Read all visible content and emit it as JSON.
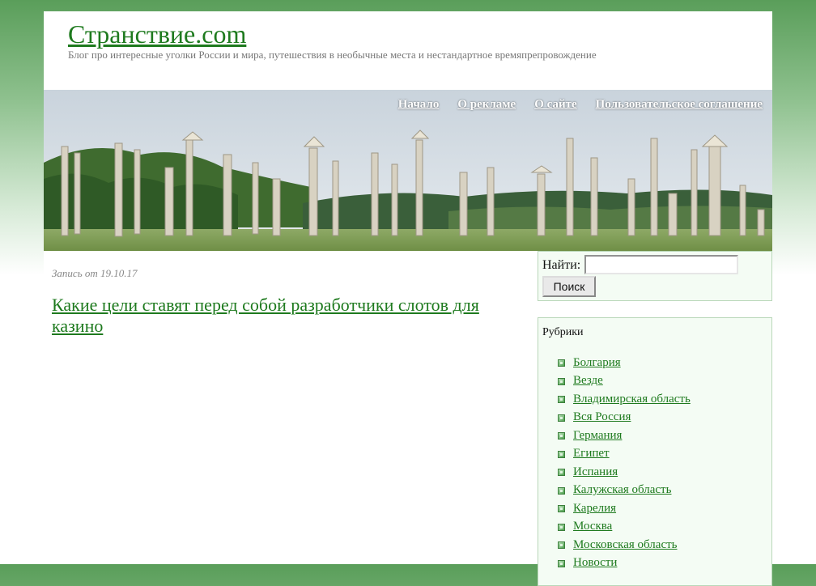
{
  "header": {
    "site_title": "Странствие.com",
    "tagline": "Блог про интересные уголки России и мира, путешествия в необычные места и нестандартное времяпрепровождение"
  },
  "nav": [
    {
      "label": "Начало"
    },
    {
      "label": "О рекламе"
    },
    {
      "label": "О сайте"
    },
    {
      "label": "Пользовательское соглашение"
    }
  ],
  "post": {
    "date": "Запись от 19.10.17",
    "title": "Какие цели ставят перед собой разработчики слотов для казино"
  },
  "search": {
    "label": "Найти:",
    "value": "",
    "button_label": "Поиск"
  },
  "categories": {
    "title": "Рубрики",
    "items": [
      {
        "label": "Болгария"
      },
      {
        "label": "Везде"
      },
      {
        "label": "Владимирская область"
      },
      {
        "label": "Вся Россия"
      },
      {
        "label": "Германия"
      },
      {
        "label": "Египет"
      },
      {
        "label": "Испания"
      },
      {
        "label": "Калужская область"
      },
      {
        "label": "Карелия"
      },
      {
        "label": "Москва"
      },
      {
        "label": "Московская область"
      },
      {
        "label": "Новости"
      }
    ]
  },
  "colors": {
    "link": "#1e7a1e",
    "background_top": "#5a9e5a",
    "widget_bg": "#f4fcf4",
    "widget_border": "#b9d7b9"
  }
}
